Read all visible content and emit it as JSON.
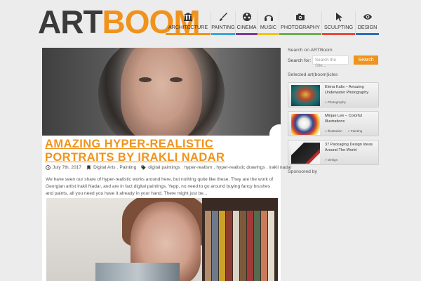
{
  "logo": {
    "part1": "ART",
    "part2": "BOOM"
  },
  "nav": [
    {
      "label": "ARCHITECTURE",
      "icon": "bank-icon",
      "color": "#f0931c"
    },
    {
      "label": "PAINTING",
      "icon": "brush-icon",
      "color": "#3ba7d8"
    },
    {
      "label": "CINEMA",
      "icon": "film-reel-icon",
      "color": "#7d3c98"
    },
    {
      "label": "MUSIC",
      "icon": "headphones-icon",
      "color": "#f2c500"
    },
    {
      "label": "PHOTOGRAPHY",
      "icon": "camera-icon",
      "color": "#6ab04c"
    },
    {
      "label": "SCULPTING",
      "icon": "cursor-icon",
      "color": "#e74c3c"
    },
    {
      "label": "DESIGN",
      "icon": "eye-icon",
      "color": "#2c6fb7"
    }
  ],
  "post": {
    "title": "AMAZING HYPER-REALISTIC PORTRAITS BY IRAKLI NADAR",
    "date": "July 7th, 2017",
    "categories": [
      "Digital Arts",
      "Painting"
    ],
    "tags": [
      "digital paintings",
      "hyper-realism",
      "hyper-realistic drawings",
      "irakli nadar"
    ],
    "excerpt": "We have seen our share of hyper-realistic works around here, but nothing quite like these. They are the work of Georgian artist Irakli Nadar, and are in fact digital paintings. Yepp, no need to go around buying fancy brushes and paints, all you need you have it already in your hand. There might just be..."
  },
  "sidebar": {
    "search_heading": "Search on ARTBoom",
    "search_label": "Search for:",
    "search_placeholder": "Search the Site...",
    "search_button": "Search",
    "selected_heading": "Selected art(boom)icles",
    "articles": [
      {
        "title": "Elena Kalis – Amazing Underwater Photography",
        "cats": [
          "Photography"
        ]
      },
      {
        "title": "Minjae Lee – Colorful Illustrations",
        "cats": [
          "Illustration",
          "Painting"
        ]
      },
      {
        "title": "37 Packaging Design Ideas Around The World",
        "cats": [
          "Design"
        ]
      }
    ],
    "sponsored_heading": "Sponsored by"
  }
}
